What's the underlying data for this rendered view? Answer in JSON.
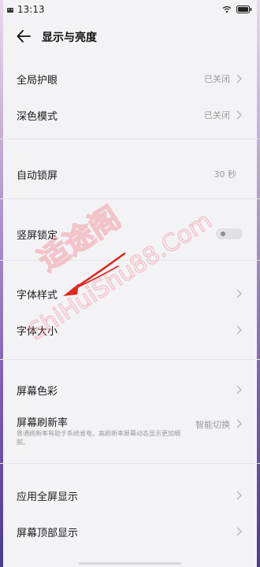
{
  "status_bar": {
    "time": "13:13",
    "battery_level": 1.0
  },
  "header": {
    "title": "显示与亮度"
  },
  "sections": {
    "eye_care": {
      "global_eye_label": "全局护眼",
      "global_eye_value": "已关闭",
      "dark_mode_label": "深色模式",
      "dark_mode_value": "已关闭"
    },
    "lock": {
      "auto_lock_label": "自动锁屏",
      "auto_lock_value": "30 秒",
      "portrait_lock_label": "竖屏锁定",
      "portrait_lock_on": false
    },
    "font": {
      "font_style_label": "字体样式",
      "font_size_label": "字体大小"
    },
    "screen": {
      "screen_color_label": "屏幕色彩",
      "refresh_rate_label": "屏幕刷新率",
      "refresh_rate_desc": "普通刷新率有助于系统省电，高刷新率屏幕动态显示更加细腻。",
      "refresh_rate_value": "智能切换"
    },
    "display": {
      "fullscreen_label": "应用全屏显示",
      "top_display_label": "屏幕顶部显示"
    }
  },
  "watermark": {
    "text_cn": "适途阁",
    "text_en": "ShiHuiShu88.Com"
  },
  "colors": {
    "background": "#f3f3f6",
    "divider": "#e6e6ea",
    "annotation_red": "#e0281e",
    "watermark_pink": "#f28b94"
  }
}
